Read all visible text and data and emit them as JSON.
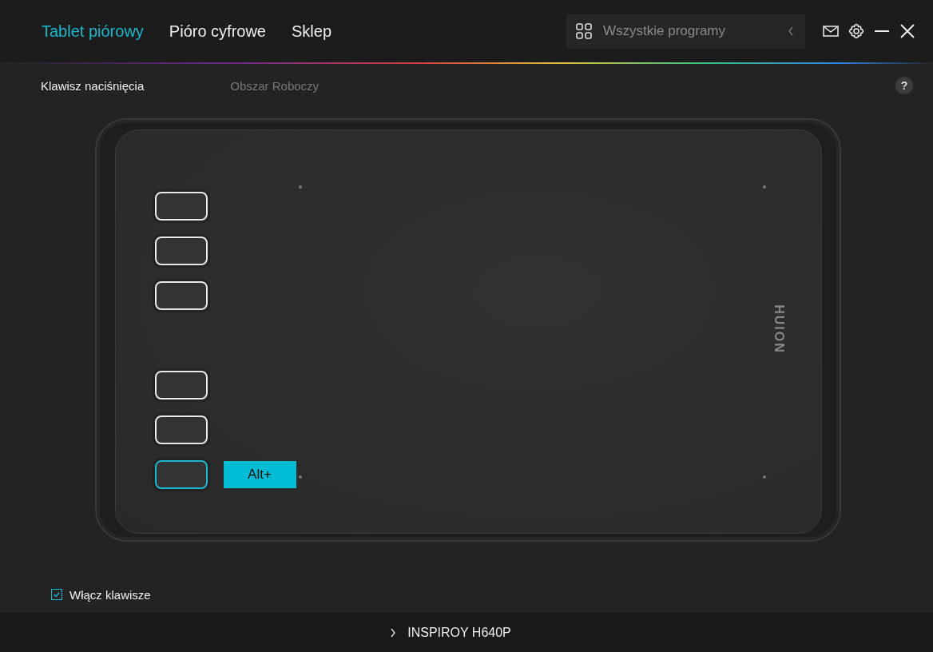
{
  "nav_tabs": [
    {
      "label": "Tablet piórowy",
      "selected": true
    },
    {
      "label": "Pióro cyfrowe",
      "selected": false
    },
    {
      "label": "Sklep",
      "selected": false
    }
  ],
  "app_selector": {
    "value": "Wszystkie programy"
  },
  "sub_tabs": [
    {
      "label": "Klawisz naciśnięcia",
      "selected": true
    },
    {
      "label": "Obszar Roboczy",
      "selected": false
    }
  ],
  "help": "?",
  "tablet": {
    "logo": "HUION",
    "keys": [
      {
        "selected": false
      },
      {
        "selected": false
      },
      {
        "selected": false
      },
      {
        "selected": false
      },
      {
        "selected": false
      },
      {
        "selected": true,
        "label": "Alt+"
      }
    ]
  },
  "enable_keys": {
    "label": "Włącz klawisze",
    "checked": true
  },
  "device": {
    "name": "INSPIROY H640P"
  }
}
